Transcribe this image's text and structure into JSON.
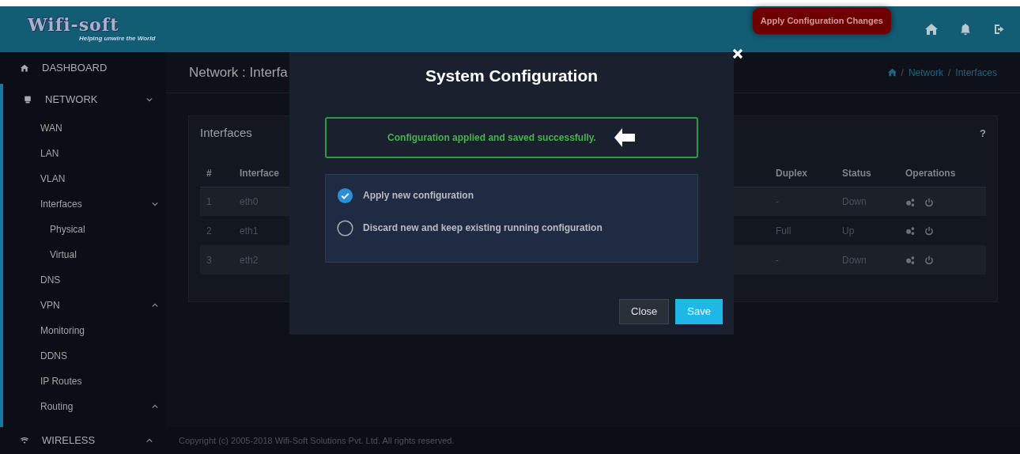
{
  "header": {
    "logo": "Wifi-soft",
    "tagline": "Helping unwire the World",
    "apply_button": "Apply Configuration Changes"
  },
  "sidebar": {
    "items": [
      {
        "label": "DASHBOARD"
      },
      {
        "label": "NETWORK",
        "expanded": true,
        "children": [
          {
            "label": "WAN"
          },
          {
            "label": "LAN"
          },
          {
            "label": "VLAN"
          },
          {
            "label": "Interfaces",
            "expanded": true,
            "children": [
              {
                "label": "Physical"
              },
              {
                "label": "Virtual"
              }
            ]
          },
          {
            "label": "DNS"
          },
          {
            "label": "VPN",
            "expanded": false
          },
          {
            "label": "Monitoring"
          },
          {
            "label": "DDNS"
          },
          {
            "label": "IP Routes"
          },
          {
            "label": "Routing",
            "expanded": false
          }
        ]
      },
      {
        "label": "WIRELESS",
        "expanded": false
      }
    ]
  },
  "page": {
    "title": "Network : Interfa",
    "breadcrumb": [
      {
        "label": "/",
        "kind": "separator"
      },
      {
        "label": "Network",
        "kind": "link"
      },
      {
        "label": "/",
        "kind": "separator"
      },
      {
        "label": "Interfaces",
        "kind": "link"
      }
    ]
  },
  "card": {
    "title": "Interfaces",
    "help": "?",
    "table": {
      "columns": [
        "#",
        "Interface",
        "Duplex",
        "Status",
        "Operations"
      ],
      "rows": [
        {
          "num": "1",
          "interface": "eth0",
          "duplex": "-",
          "status": "Down"
        },
        {
          "num": "2",
          "interface": "eth1",
          "duplex": "Full",
          "status": "Up"
        },
        {
          "num": "3",
          "interface": "eth2",
          "duplex": "-",
          "status": "Down"
        }
      ]
    }
  },
  "modal": {
    "title": "System Configuration",
    "message": "Configuration applied and saved successfully.",
    "options": [
      {
        "label": "Apply new configuration",
        "selected": true
      },
      {
        "label": "Discard new and keep existing running configuration",
        "selected": false
      }
    ],
    "buttons": [
      {
        "label": "Close",
        "kind": "secondary"
      },
      {
        "label": "Save",
        "kind": "primary"
      }
    ]
  },
  "footer": "Copyright (c) 2005-2018 Wifi-Soft Solutions Pvt. Ltd. All rights reserved."
}
